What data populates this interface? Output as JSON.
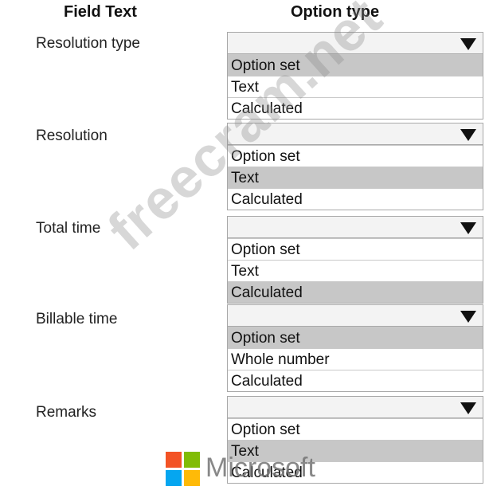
{
  "headers": {
    "field_text": "Field Text",
    "option_type": "Option type"
  },
  "rows": [
    {
      "label": "Resolution type",
      "options": [
        "Option set",
        "Text",
        "Calculated"
      ],
      "selected_index": 0
    },
    {
      "label": "Resolution",
      "options": [
        "Option set",
        "Text",
        "Calculated"
      ],
      "selected_index": 1
    },
    {
      "label": "Total time",
      "options": [
        "Option set",
        "Text",
        "Calculated"
      ],
      "selected_index": 2
    },
    {
      "label": "Billable time",
      "options": [
        "Option set",
        "Whole number",
        "Calculated"
      ],
      "selected_index": 0
    },
    {
      "label": "Remarks",
      "options": [
        "Option set",
        "Text",
        "Calculated"
      ],
      "selected_index": 1
    }
  ],
  "watermark": "freecram.net",
  "brand": {
    "name": "Microsoft",
    "colors": [
      "#f35325",
      "#81bc06",
      "#05a6f0",
      "#ffba08"
    ]
  },
  "colors": {
    "selected_option_bg": "#c7c7c7",
    "dropdown_head_bg": "#f3f3f3",
    "border": "#a8a8a8"
  }
}
